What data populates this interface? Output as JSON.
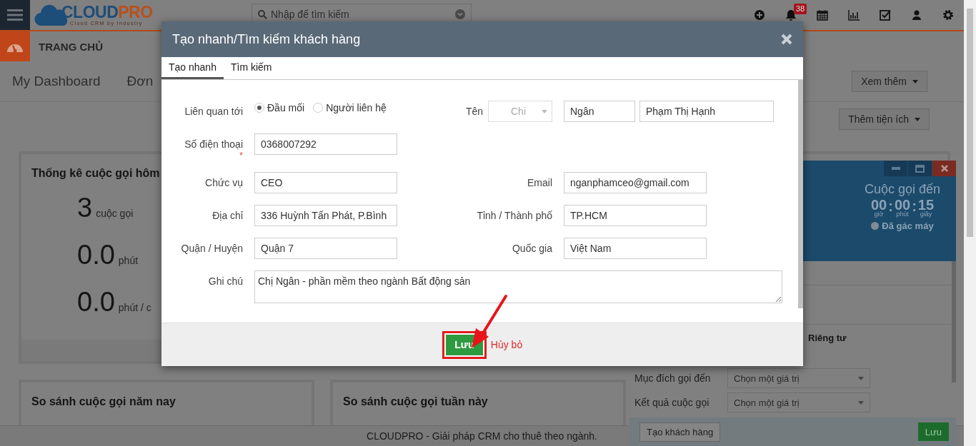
{
  "topbar": {
    "logo": {
      "words": [
        "CLOUD",
        "PRO"
      ],
      "tagline": "Cloud CRM by Industry"
    },
    "search": {
      "placeholder": "Nhập để tìm kiếm"
    },
    "notification_count": "38"
  },
  "nav": {
    "section": "TRANG CHỦ"
  },
  "dashboard": {
    "tabs": [
      {
        "label": "My Dashboard"
      },
      {
        "label": "Đơn"
      }
    ],
    "more_button": "Xem thêm",
    "add_widget_button": "Thêm tiện ích",
    "today_card": {
      "title": "Thống kê cuộc gọi hôm",
      "stats": [
        {
          "value": "3",
          "unit": "cuộc gọi"
        },
        {
          "value": "0.0",
          "unit": "phút"
        },
        {
          "value": "0.0",
          "unit": "phút / c"
        }
      ]
    },
    "compare_cards": [
      {
        "title": "So sánh cuộc gọi năm nay"
      },
      {
        "title": "So sánh cuộc gọi tuần này"
      }
    ]
  },
  "footer": "CLOUDPRO - Giải pháp CRM cho thuê theo ngành.",
  "call_panel": {
    "title": "Cuộc gọi đến",
    "timer": {
      "parts": [
        {
          "value": "00",
          "unit": "giờ"
        },
        {
          "value": "00",
          "unit": "phút"
        },
        {
          "value": "15",
          "unit": "giây"
        }
      ],
      "separators": [
        ":",
        ":"
      ]
    },
    "status": "Đã gác máy",
    "privacy_option": "Riêng tư",
    "fields": [
      {
        "label": "Mục đích gọi đến",
        "placeholder": "Chọn một giá trị"
      },
      {
        "label": "Kết quả cuộc gọi",
        "placeholder": "Chọn một giá trị"
      }
    ],
    "create_button": "Tạo khách hàng",
    "save_button": "Lưu"
  },
  "modal": {
    "title": "Tạo nhanh/Tìm kiếm khách hàng",
    "tabs": [
      {
        "label": "Tạo nhanh",
        "selected": true
      },
      {
        "label": "Tìm kiếm",
        "selected": false
      }
    ],
    "related_to": {
      "label": "Liên quan tới",
      "options": [
        {
          "label": "Đầu mối",
          "selected": true
        },
        {
          "label": "Người liên hệ",
          "selected": false
        }
      ]
    },
    "name": {
      "label": "Tên",
      "salutation": "Chi",
      "first_name": "Ngân",
      "last_name": "Phạm Thị Hạnh"
    },
    "phone": {
      "label": "Số điện thoại",
      "required_mark": "*",
      "value": "0368007292"
    },
    "field_rows": [
      {
        "left": {
          "label": "Chức vụ",
          "value": "CEO"
        },
        "right": {
          "label": "Email",
          "value": "nganphamceo@gmail.com"
        }
      },
      {
        "left": {
          "label": "Địa chỉ",
          "value": "336 Huỳnh Tấn Phát, P.Bình"
        },
        "right": {
          "label": "Tỉnh / Thành phố",
          "value": "TP.HCM"
        }
      },
      {
        "left": {
          "label": "Quận / Huyện",
          "value": "Quận 7"
        },
        "right": {
          "label": "Quốc gia",
          "value": "Việt Nam"
        }
      }
    ],
    "note": {
      "label": "Ghi chú",
      "value": "Chị Ngân - phần mềm theo ngành Bất động sản"
    },
    "save_button": "Lưu",
    "cancel_link": "Hủy bỏ"
  }
}
